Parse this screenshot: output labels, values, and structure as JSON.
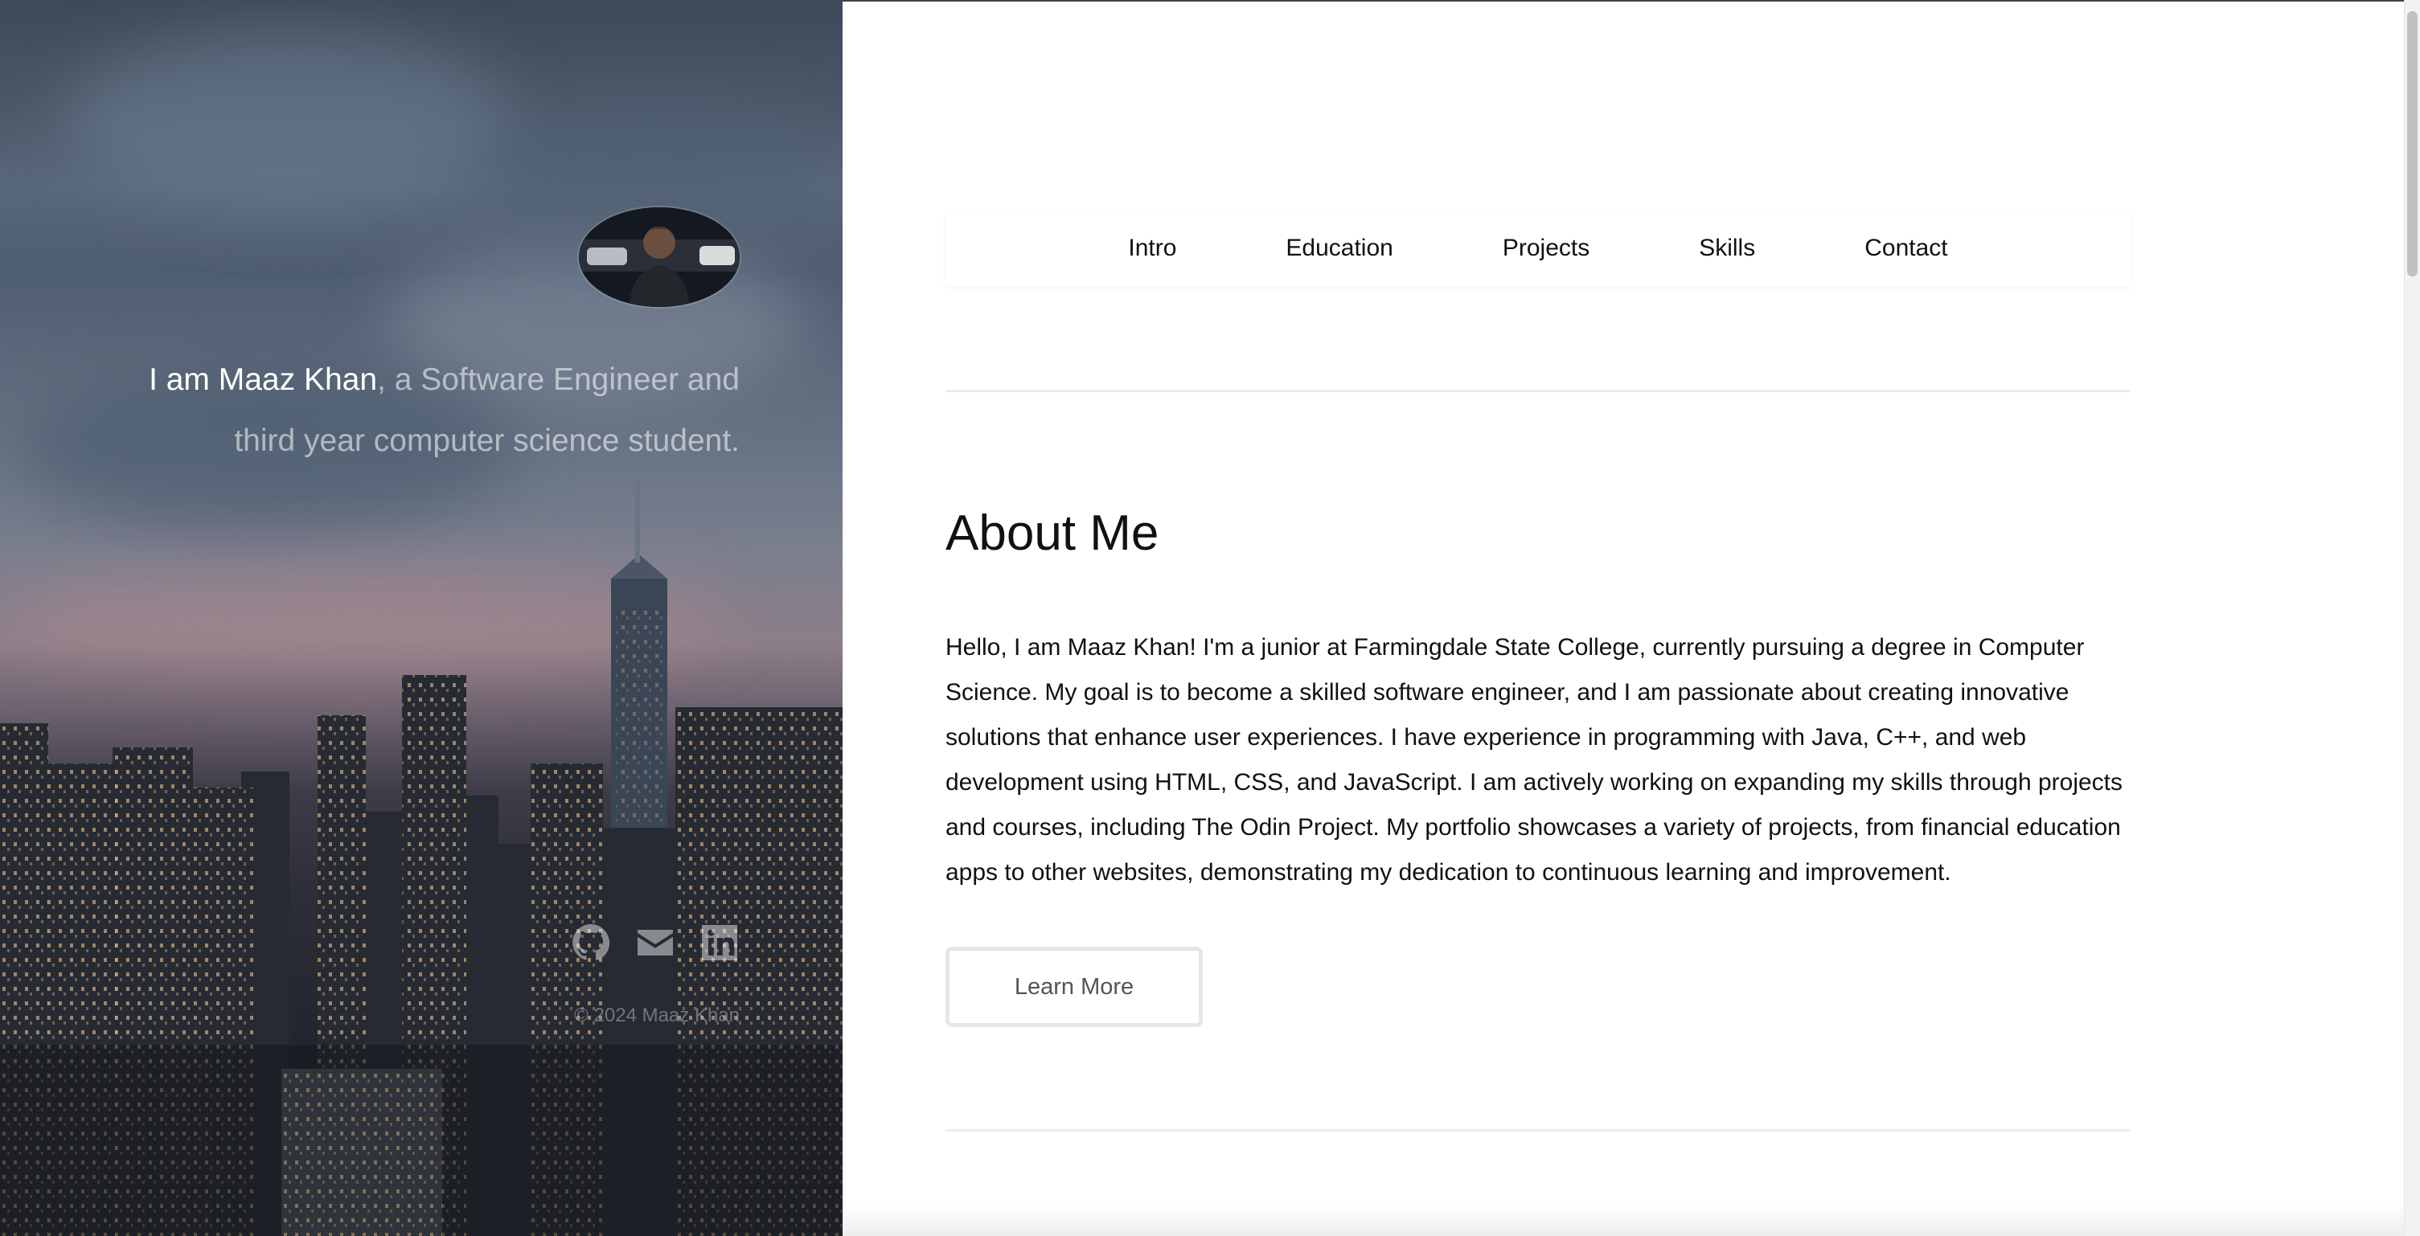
{
  "hero": {
    "intro_strong": "I am Maaz Khan",
    "intro_rest": ", a Software Engineer and third year computer science student.",
    "avatar_alt": "Profile photo of Maaz Khan",
    "social": [
      "github-icon",
      "mail-icon",
      "linkedin-icon"
    ],
    "copyright": "© 2024 Maaz Khan"
  },
  "nav": {
    "items": [
      {
        "label": "Intro"
      },
      {
        "label": "Education"
      },
      {
        "label": "Projects"
      },
      {
        "label": "Skills"
      },
      {
        "label": "Contact"
      }
    ]
  },
  "about": {
    "title": "About Me",
    "body": "Hello, I am Maaz Khan! I'm a junior at Farmingdale State College, currently pursuing a degree in Computer Science. My goal is to become a skilled software engineer, and I am passionate about creating innovative solutions that enhance user experiences. I have experience in programming with Java, C++, and web development using HTML, CSS, and JavaScript. I am actively working on expanding my skills through projects and courses, including The Odin Project. My portfolio showcases a variety of projects, from financial education apps to other websites, demonstrating my dedication to continuous learning and improvement.",
    "button_label": "Learn More"
  },
  "colors": {
    "text": "#111111",
    "muted_button_text": "#555555",
    "divider": "#ececec"
  }
}
